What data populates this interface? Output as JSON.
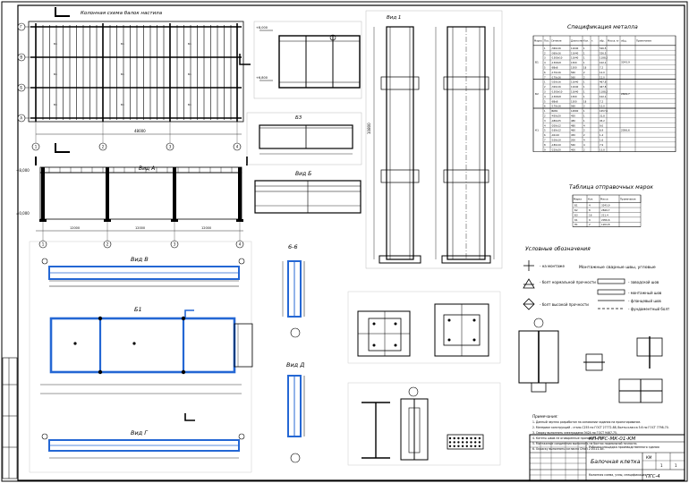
{
  "views": {
    "plan_title": "Колонная схема балок настила",
    "vid_a": "Вид А",
    "vid_b": "Вид Б",
    "vid_v": "Вид В",
    "vid_g": "Вид Г",
    "vid_d": "Вид Д",
    "b1": "Б1",
    "b3": "Б3",
    "section_6": "6-6",
    "vid_1": "Вид 1"
  },
  "axes": {
    "rows": [
      "А",
      "Б",
      "В",
      "Г"
    ],
    "cols": [
      "1",
      "2",
      "3",
      "4",
      "5"
    ]
  },
  "spec_table": {
    "title": "Спецификация металла",
    "headers": [
      "Марка",
      "Поз.",
      "Сечение",
      "Длина мм",
      "Кол.",
      "т.",
      "обр.",
      "Масса, кг",
      "общ.",
      "Примечание"
    ],
    "groups": [
      {
        "mark": "Б1",
        "total": "3243,9",
        "rows": [
          [
            "1",
            "-360х16",
            "11640",
            "1",
            "",
            "526,5",
            ""
          ],
          [
            "2",
            "-360х16",
            "11640",
            "1",
            "",
            "526,5",
            ""
          ],
          [
            "3",
            "-1300х10",
            "11640",
            "1",
            "",
            "1188,2",
            ""
          ],
          [
            "4",
            "-1300х8",
            "1300",
            "1",
            "",
            "102,1",
            ""
          ],
          [
            "5",
            "-88х8",
            "1300",
            "18",
            "",
            "7,2",
            ""
          ],
          [
            "6",
            "-170х16",
            "560",
            "2",
            "",
            "12,0",
            ""
          ],
          [
            "7",
            "-170х16",
            "560",
            "2",
            "",
            "12,0",
            ""
          ]
        ]
      },
      {
        "mark": "Б2",
        "total": "2849,7",
        "rows": [
          [
            "1",
            "-320х16",
            "11640",
            "1",
            "",
            "467,8",
            ""
          ],
          [
            "2",
            "-320х16",
            "11640",
            "1",
            "",
            "467,8",
            ""
          ],
          [
            "3",
            "-1300х10",
            "11640",
            "1",
            "",
            "1188,2",
            ""
          ],
          [
            "4",
            "-1300х8",
            "1300",
            "1",
            "",
            "102,1",
            ""
          ],
          [
            "5",
            "-88х8",
            "1300",
            "18",
            "",
            "7,2",
            ""
          ],
          [
            "6",
            "-170х16",
            "560",
            "2",
            "",
            "12,0",
            ""
          ]
        ]
      },
      {
        "mark": "К1",
        "total": "2056,6",
        "rows": [
          [
            "1",
            "I60Б1",
            "14800",
            "1",
            "",
            "1657,6",
            ""
          ],
          [
            "2",
            "-450х20",
            "450",
            "1",
            "",
            "31,8",
            ""
          ],
          [
            "3",
            "-480х25",
            "480",
            "1",
            "",
            "45,2",
            ""
          ],
          [
            "4",
            "-200х12",
            "480",
            "4",
            "",
            "9,0",
            ""
          ],
          [
            "5",
            "-160х12",
            "460",
            "2",
            "",
            "6,9",
            ""
          ],
          [
            "6",
            "-40х10",
            "450",
            "2",
            "",
            "1,4",
            ""
          ],
          [
            "7",
            "-100х10",
            "200",
            "4",
            "",
            "1,6",
            ""
          ],
          [
            "8",
            "-180х10",
            "560",
            "4",
            "",
            "7,9",
            ""
          ],
          [
            "9",
            "-220х20",
            "400",
            "2",
            "",
            "13,8",
            ""
          ]
        ]
      }
    ]
  },
  "support_table": {
    "title": "Таблица отправочных марок",
    "headers": [
      "Марка",
      "Кол.",
      "Масса",
      "Примечание"
    ],
    "rows": [
      [
        "Б1",
        "4",
        "3243,9",
        ""
      ],
      [
        "Б2",
        "8",
        "2849,7",
        ""
      ],
      [
        "Б3",
        "16",
        "211,4",
        ""
      ],
      [
        "К1",
        "9",
        "2056,6",
        ""
      ],
      [
        "Н1",
        "2",
        "1204,8",
        ""
      ]
    ]
  },
  "legend": {
    "title": "Условные обозначения",
    "bolts_title": "Монтажные сварные швы, угловые",
    "items": [
      "- на монтаже",
      "- болт нормальной прочности",
      "- болт высокой прочности",
      "- заводской шов",
      "- монтажный шов",
      "- фланцевый шов",
      "- фундаментный болт"
    ]
  },
  "notes": {
    "title": "Примечания:",
    "lines": [
      "1. Данный чертеж разработан на основании задания на проектирование.",
      "2. Материал конструкций - сталь С255 по ГОСТ 27772-88, болты класса 5.6 по ГОСТ 7798-70.",
      "3. Сварку выполнять электродами Э42А по ГОСТ 9467-75.",
      "4. Катеты швов не оговоренные принимать 6 мм.",
      "5. Монтажные соединения выполнять на болтах нормальной точности.",
      "6. Окраску выполнить согласно СНиП 2.03.11-85."
    ]
  },
  "title_block": {
    "code": "КП-ПГС-МК-01-КМ",
    "project": "Рабочая площадка производственного здания",
    "sheet_name": "Балочная клетка",
    "detail": "Колонная схема, узлы, спецификация",
    "org": "ПГС-4",
    "stage": "КМ",
    "sheet": "1",
    "sheets": "1"
  },
  "dims": {
    "span_total": "48000",
    "span": "12000",
    "row_dims": [
      "6000",
      "6000",
      "6000"
    ],
    "height": "10800",
    "beam_len": "11640",
    "elev_top": "+8,000",
    "elev_mid": "+6,800",
    "elev_zero": "±0,000"
  }
}
